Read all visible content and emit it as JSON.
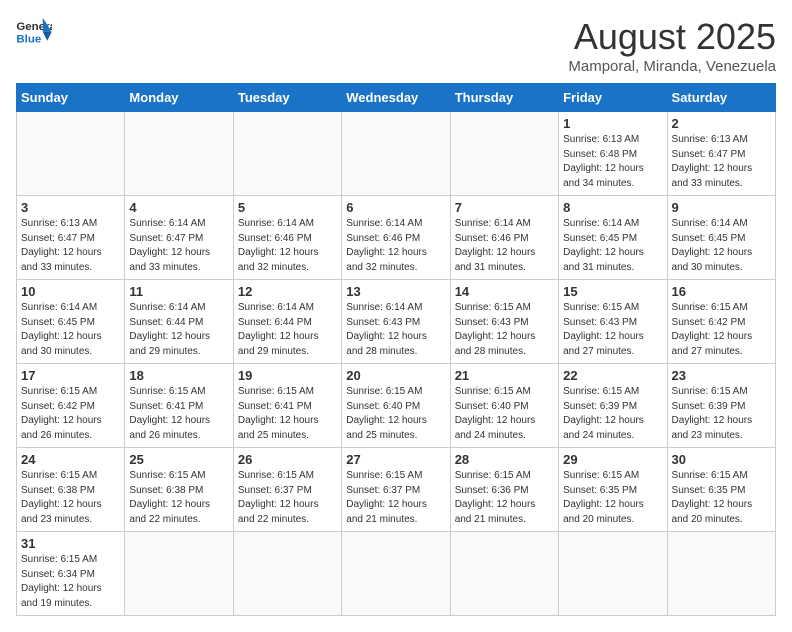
{
  "header": {
    "logo_general": "General",
    "logo_blue": "Blue",
    "title": "August 2025",
    "subtitle": "Mamporal, Miranda, Venezuela"
  },
  "days_of_week": [
    "Sunday",
    "Monday",
    "Tuesday",
    "Wednesday",
    "Thursday",
    "Friday",
    "Saturday"
  ],
  "weeks": [
    [
      {
        "day": "",
        "info": ""
      },
      {
        "day": "",
        "info": ""
      },
      {
        "day": "",
        "info": ""
      },
      {
        "day": "",
        "info": ""
      },
      {
        "day": "",
        "info": ""
      },
      {
        "day": "1",
        "info": "Sunrise: 6:13 AM\nSunset: 6:48 PM\nDaylight: 12 hours and 34 minutes."
      },
      {
        "day": "2",
        "info": "Sunrise: 6:13 AM\nSunset: 6:47 PM\nDaylight: 12 hours and 33 minutes."
      }
    ],
    [
      {
        "day": "3",
        "info": "Sunrise: 6:13 AM\nSunset: 6:47 PM\nDaylight: 12 hours and 33 minutes."
      },
      {
        "day": "4",
        "info": "Sunrise: 6:14 AM\nSunset: 6:47 PM\nDaylight: 12 hours and 33 minutes."
      },
      {
        "day": "5",
        "info": "Sunrise: 6:14 AM\nSunset: 6:46 PM\nDaylight: 12 hours and 32 minutes."
      },
      {
        "day": "6",
        "info": "Sunrise: 6:14 AM\nSunset: 6:46 PM\nDaylight: 12 hours and 32 minutes."
      },
      {
        "day": "7",
        "info": "Sunrise: 6:14 AM\nSunset: 6:46 PM\nDaylight: 12 hours and 31 minutes."
      },
      {
        "day": "8",
        "info": "Sunrise: 6:14 AM\nSunset: 6:45 PM\nDaylight: 12 hours and 31 minutes."
      },
      {
        "day": "9",
        "info": "Sunrise: 6:14 AM\nSunset: 6:45 PM\nDaylight: 12 hours and 30 minutes."
      }
    ],
    [
      {
        "day": "10",
        "info": "Sunrise: 6:14 AM\nSunset: 6:45 PM\nDaylight: 12 hours and 30 minutes."
      },
      {
        "day": "11",
        "info": "Sunrise: 6:14 AM\nSunset: 6:44 PM\nDaylight: 12 hours and 29 minutes."
      },
      {
        "day": "12",
        "info": "Sunrise: 6:14 AM\nSunset: 6:44 PM\nDaylight: 12 hours and 29 minutes."
      },
      {
        "day": "13",
        "info": "Sunrise: 6:14 AM\nSunset: 6:43 PM\nDaylight: 12 hours and 28 minutes."
      },
      {
        "day": "14",
        "info": "Sunrise: 6:15 AM\nSunset: 6:43 PM\nDaylight: 12 hours and 28 minutes."
      },
      {
        "day": "15",
        "info": "Sunrise: 6:15 AM\nSunset: 6:43 PM\nDaylight: 12 hours and 27 minutes."
      },
      {
        "day": "16",
        "info": "Sunrise: 6:15 AM\nSunset: 6:42 PM\nDaylight: 12 hours and 27 minutes."
      }
    ],
    [
      {
        "day": "17",
        "info": "Sunrise: 6:15 AM\nSunset: 6:42 PM\nDaylight: 12 hours and 26 minutes."
      },
      {
        "day": "18",
        "info": "Sunrise: 6:15 AM\nSunset: 6:41 PM\nDaylight: 12 hours and 26 minutes."
      },
      {
        "day": "19",
        "info": "Sunrise: 6:15 AM\nSunset: 6:41 PM\nDaylight: 12 hours and 25 minutes."
      },
      {
        "day": "20",
        "info": "Sunrise: 6:15 AM\nSunset: 6:40 PM\nDaylight: 12 hours and 25 minutes."
      },
      {
        "day": "21",
        "info": "Sunrise: 6:15 AM\nSunset: 6:40 PM\nDaylight: 12 hours and 24 minutes."
      },
      {
        "day": "22",
        "info": "Sunrise: 6:15 AM\nSunset: 6:39 PM\nDaylight: 12 hours and 24 minutes."
      },
      {
        "day": "23",
        "info": "Sunrise: 6:15 AM\nSunset: 6:39 PM\nDaylight: 12 hours and 23 minutes."
      }
    ],
    [
      {
        "day": "24",
        "info": "Sunrise: 6:15 AM\nSunset: 6:38 PM\nDaylight: 12 hours and 23 minutes."
      },
      {
        "day": "25",
        "info": "Sunrise: 6:15 AM\nSunset: 6:38 PM\nDaylight: 12 hours and 22 minutes."
      },
      {
        "day": "26",
        "info": "Sunrise: 6:15 AM\nSunset: 6:37 PM\nDaylight: 12 hours and 22 minutes."
      },
      {
        "day": "27",
        "info": "Sunrise: 6:15 AM\nSunset: 6:37 PM\nDaylight: 12 hours and 21 minutes."
      },
      {
        "day": "28",
        "info": "Sunrise: 6:15 AM\nSunset: 6:36 PM\nDaylight: 12 hours and 21 minutes."
      },
      {
        "day": "29",
        "info": "Sunrise: 6:15 AM\nSunset: 6:35 PM\nDaylight: 12 hours and 20 minutes."
      },
      {
        "day": "30",
        "info": "Sunrise: 6:15 AM\nSunset: 6:35 PM\nDaylight: 12 hours and 20 minutes."
      }
    ],
    [
      {
        "day": "31",
        "info": "Sunrise: 6:15 AM\nSunset: 6:34 PM\nDaylight: 12 hours and 19 minutes."
      },
      {
        "day": "",
        "info": ""
      },
      {
        "day": "",
        "info": ""
      },
      {
        "day": "",
        "info": ""
      },
      {
        "day": "",
        "info": ""
      },
      {
        "day": "",
        "info": ""
      },
      {
        "day": "",
        "info": ""
      }
    ]
  ]
}
